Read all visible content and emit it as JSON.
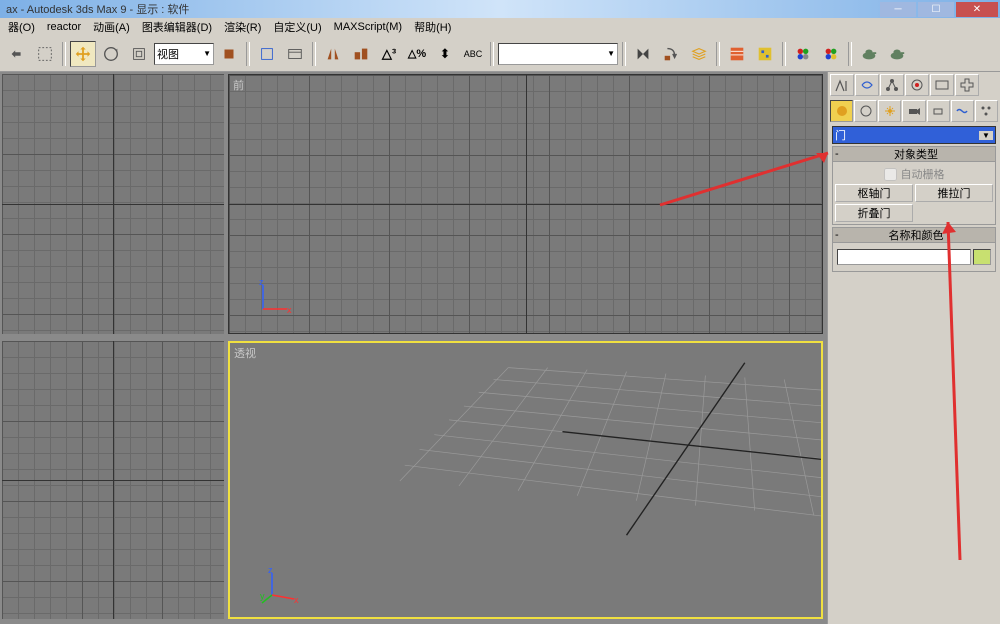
{
  "window": {
    "title": "ax   - Autodesk 3ds Max 9    - 显示 : 软件"
  },
  "menu": {
    "items": [
      "器(O)",
      "reactor",
      "动画(A)",
      "图表编辑器(D)",
      "渲染(R)",
      "自定义(U)",
      "MAXScript(M)",
      "帮助(H)"
    ]
  },
  "toolbar": {
    "view_dropdown": "视图"
  },
  "viewports": {
    "top_right_label": "前",
    "bottom_right_label": "透视",
    "axis": {
      "x": "x",
      "y": "y",
      "z": "z"
    }
  },
  "panel": {
    "dropdown_value": "门",
    "rollout_object_type": "对象类型",
    "autogrid_label": "自动栅格",
    "buttons": {
      "pivot_door": "枢轴门",
      "sliding_door": "推拉门",
      "folding_door": "折叠门"
    },
    "rollout_name_color": "名称和颜色",
    "colors": {
      "swatch": "#c8e070"
    }
  }
}
